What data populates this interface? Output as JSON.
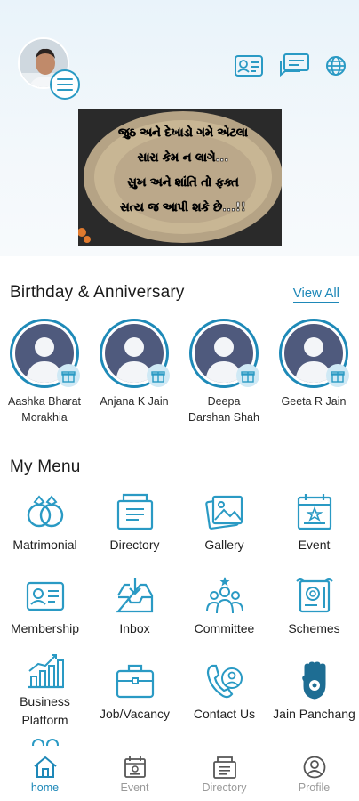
{
  "colors": {
    "accent": "#1e88b8",
    "icon_stroke": "#2a9ac4",
    "text": "#1b1b1b",
    "muted": "#9a9a9a",
    "avatar_bg": "#4f5a7d"
  },
  "header": {
    "icons": [
      "id-card-icon",
      "chat-icon",
      "globe-icon"
    ]
  },
  "banner": {
    "lines": [
      "જુઠ અને દેખાડો ગમે એટલા",
      "સારા કેમ ન લાગે...",
      "સુખ અને શાંતિ તો ફક્ત",
      "સત્ય જ આપી શકે છે...!!"
    ]
  },
  "birthday": {
    "title": "Birthday & Anniversary",
    "view_all": "View All",
    "people": [
      {
        "line1": "Aashka Bharat",
        "line2": "Morakhia"
      },
      {
        "line1": "Anjana K Jain",
        "line2": ""
      },
      {
        "line1": "Deepa",
        "line2": "Darshan Shah"
      },
      {
        "line1": "Geeta R Jain",
        "line2": ""
      }
    ]
  },
  "menu": {
    "title": "My Menu",
    "items": [
      {
        "label": "Matrimonial",
        "label2": "",
        "icon": "rings-icon"
      },
      {
        "label": "Directory",
        "label2": "",
        "icon": "directory-icon"
      },
      {
        "label": "Gallery",
        "label2": "",
        "icon": "gallery-icon"
      },
      {
        "label": "Event",
        "label2": "",
        "icon": "event-icon"
      },
      {
        "label": "Membership",
        "label2": "",
        "icon": "membership-card-icon"
      },
      {
        "label": "Inbox",
        "label2": "",
        "icon": "inbox-icon"
      },
      {
        "label": "Committee",
        "label2": "",
        "icon": "committee-icon"
      },
      {
        "label": "Schemes",
        "label2": "",
        "icon": "schemes-icon"
      },
      {
        "label": "Business",
        "label2": "Platform",
        "icon": "business-chart-icon"
      },
      {
        "label": "Job/Vacancy",
        "label2": "",
        "icon": "briefcase-icon"
      },
      {
        "label": "Contact Us",
        "label2": "",
        "icon": "contact-phone-icon"
      },
      {
        "label": "Jain Panchang",
        "label2": "",
        "icon": "jain-hand-icon"
      }
    ]
  },
  "bottom_nav": {
    "items": [
      {
        "label": "home",
        "icon": "home-icon",
        "active": true
      },
      {
        "label": "Event",
        "icon": "event-icon",
        "active": false
      },
      {
        "label": "Directory",
        "icon": "directory-icon",
        "active": false
      },
      {
        "label": "Profile",
        "icon": "profile-icon",
        "active": false
      }
    ]
  }
}
